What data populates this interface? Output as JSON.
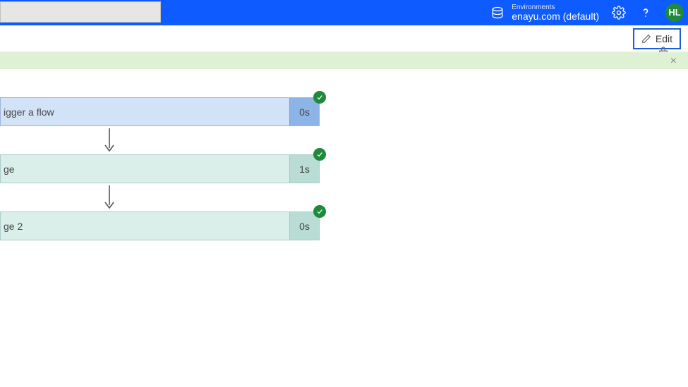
{
  "header": {
    "search_value": "",
    "env_label": "Environments",
    "env_name": "enayu.com (default)",
    "avatar_initials": "HL"
  },
  "toolbar": {
    "edit_label": "Edit"
  },
  "success_bar": {
    "close": "×"
  },
  "flow": {
    "steps": [
      {
        "label": "igger a flow",
        "duration": "0s",
        "kind": "trigger",
        "status": "ok"
      },
      {
        "label": "ge",
        "duration": "1s",
        "kind": "action",
        "status": "ok"
      },
      {
        "label": "ge 2",
        "duration": "0s",
        "kind": "action",
        "status": "ok"
      }
    ]
  }
}
